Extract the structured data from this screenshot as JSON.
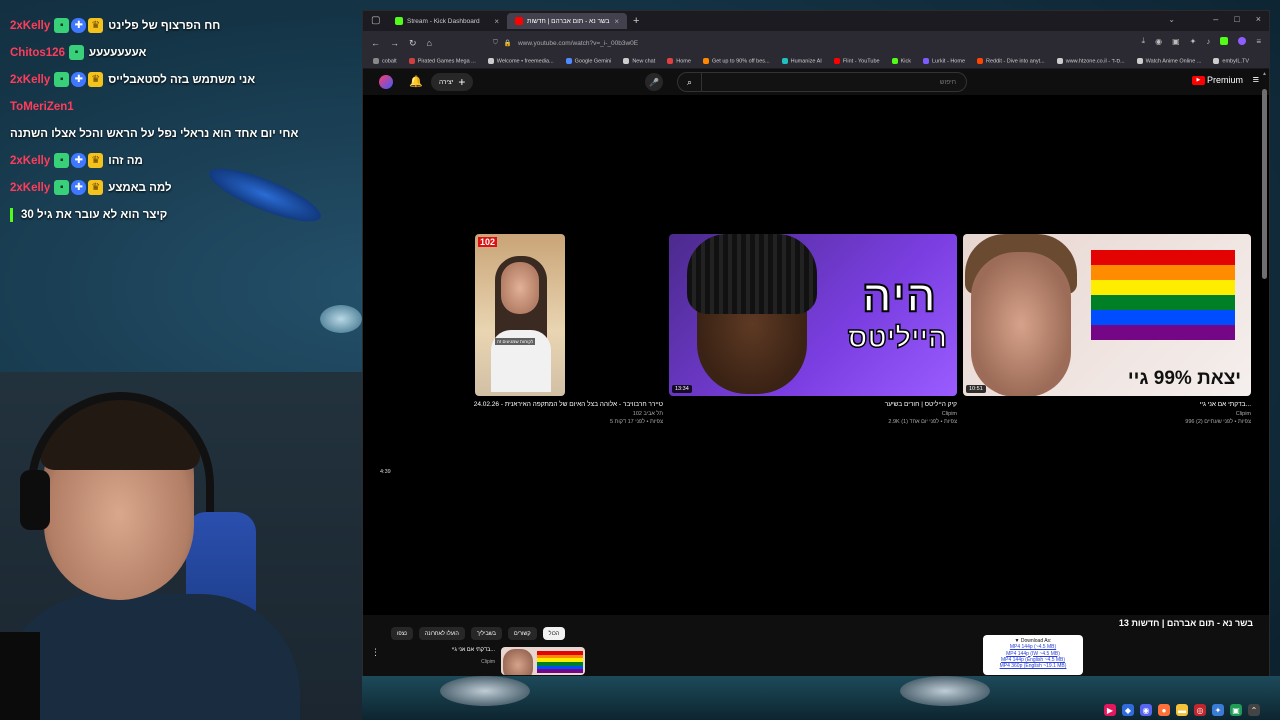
{
  "chat": {
    "messages": [
      {
        "user": "2xKelly",
        "user_color": "#ff3d5a",
        "badges": [
          "gift-icon",
          "shield-icon",
          "crown-icon"
        ],
        "text": "חח הפרצוף של פלינט"
      },
      {
        "user": "Chitos126",
        "user_color": "#ff3d5a",
        "badges": [
          "gift-icon"
        ],
        "text": "אעעעעעעע"
      },
      {
        "user": "2xKelly",
        "user_color": "#ff3d5a",
        "badges": [
          "gift-icon",
          "shield-icon",
          "crown-icon"
        ],
        "text": "אני משתמש בזה לסטאבלייס"
      },
      {
        "user": "ToMeriZen1",
        "user_color": "#ff3d5a",
        "badges": [],
        "text": ""
      },
      {
        "user": "",
        "user_color": "#ffffff",
        "badges": [],
        "text": "אחי יום אחד הוא נראלי נפל על הראש והכל אצלו השתנה"
      },
      {
        "user": "2xKelly",
        "user_color": "#ff3d5a",
        "badges": [
          "gift-icon",
          "shield-icon",
          "crown-icon"
        ],
        "text": "מה זהו"
      },
      {
        "user": "2xKelly",
        "user_color": "#ff3d5a",
        "badges": [
          "gift-icon",
          "shield-icon",
          "crown-icon"
        ],
        "text": "למה באמצע"
      },
      {
        "user": "",
        "user_color": "#ffffff",
        "badges": [],
        "text": "קיצר הוא לא עובר את גיל 30",
        "bar": true
      }
    ]
  },
  "browser": {
    "tabs": [
      {
        "label": "Stream - Kick Dashboard",
        "favicon_color": "#53fc18",
        "active": false
      },
      {
        "label": "בשר נא - תום אברהם | חדשות",
        "favicon_color": "#ff0000",
        "active": true
      }
    ],
    "url": "www.youtube.com/watch?v=_i-_00b3w0E",
    "bookmarks": [
      {
        "label": "cobalt",
        "color": "#888888"
      },
      {
        "label": "Pirated Games Mega ...",
        "color": "#d04040"
      },
      {
        "label": "Welcome • freemedia...",
        "color": "#cccccc"
      },
      {
        "label": "Google Gemini",
        "color": "#4f8bff"
      },
      {
        "label": "New chat",
        "color": "#cccccc"
      },
      {
        "label": "Home",
        "color": "#e04040"
      },
      {
        "label": "Get up to 90% off bes...",
        "color": "#ff8800"
      },
      {
        "label": "Humanize AI",
        "color": "#20c0c0"
      },
      {
        "label": "Flint - YouTube",
        "color": "#ff0000"
      },
      {
        "label": "Kick",
        "color": "#53fc18"
      },
      {
        "label": "Lurkit - Home",
        "color": "#7a5cff"
      },
      {
        "label": "Reddit - Dive into anyt...",
        "color": "#ff4500"
      },
      {
        "label": "www.htzone.co.il - ס-ד...",
        "color": "#cccccc"
      },
      {
        "label": "Watch Anime Online ...",
        "color": "#cccccc"
      },
      {
        "label": "embyIL.TV",
        "color": "#cccccc"
      }
    ]
  },
  "youtube": {
    "create_label": "יצירה",
    "search_placeholder": "חיפוש",
    "premium_label": "Premium",
    "endscreen": {
      "videos": [
        {
          "title": "בדקתי אם אני גיי...",
          "channel": "Clipim",
          "meta": "996 צפיות • לפני שעתיים (2)",
          "duration": "10:51",
          "thumb_text": "יצאת 99% גיי"
        },
        {
          "title": "קיק הייליטס | חורים בשיער",
          "channel": "Clipim",
          "meta": "2.9K צפיות • לפני יום אחד (1)",
          "duration": "13:34",
          "thumb_text_1": "היה",
          "thumb_text_2": "הייליטס"
        },
        {
          "title": "24.02.26 - טיירר חרבוויבר - אלוהה בצל האיום של המתקפה האיראנית",
          "channel": "102 תל אביב",
          "meta": "5 צפיות • לפני 17 דקות",
          "duration": "4:39",
          "thumb_logo": "102",
          "thumb_caption": "לקוחות שמגיעים זה"
        }
      ]
    },
    "video_title": "בשר נא - תום אברהם | חדשות 13",
    "chips": [
      {
        "label": "הכול",
        "active": true
      },
      {
        "label": "קשורים",
        "active": false
      },
      {
        "label": "בשביליך",
        "active": false
      },
      {
        "label": "הועלו לאחרונה",
        "active": false
      },
      {
        "label": "נצפו",
        "active": false
      }
    ],
    "sidebar_item": {
      "title": "בדקתי אם אני גיי...",
      "channel": "Clipim",
      "meta": "996 צפיות • לפני"
    },
    "download": {
      "header": "▼ Download As:",
      "options": [
        "MP4 144p (~4.5 MB)",
        "MP4 144p (IW ~4.5 MB)",
        "MP4 144p (English ~4.5 MB)",
        "MP4 360p (English ~19.1 MB)"
      ]
    }
  },
  "colors": {
    "kick_green": "#53fc18",
    "yt_red": "#ff0000",
    "chat_user_red": "#ff3d5a"
  }
}
